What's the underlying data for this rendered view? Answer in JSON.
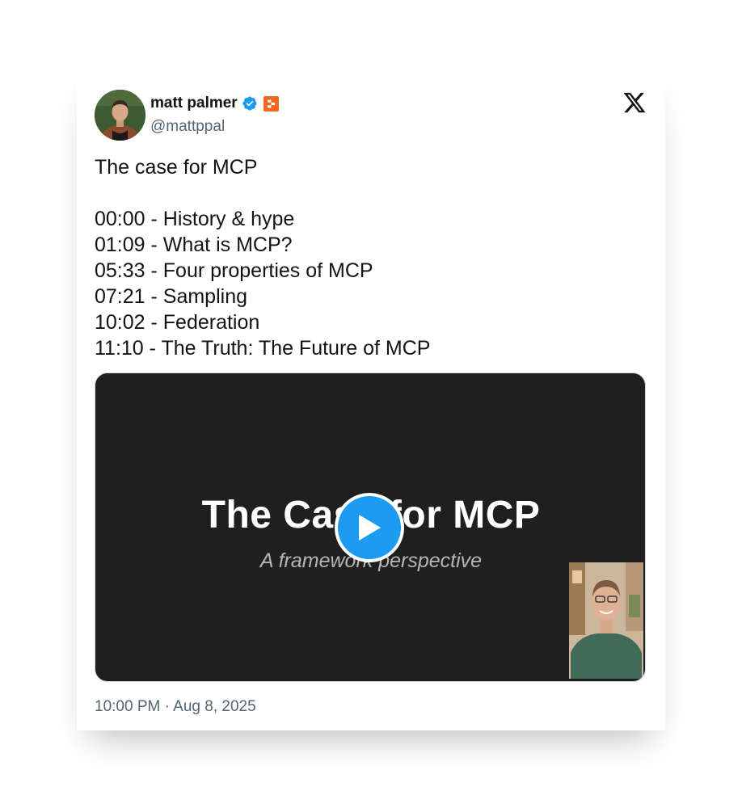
{
  "author": {
    "name": "matt palmer",
    "handle": "@mattppal",
    "verified": true,
    "avatar_icon": "profile-photo-man",
    "affiliate_badge_icon": "replit-logo",
    "affiliate_badge_color": "#F26522"
  },
  "platform_icon": "x-logo",
  "tweet": {
    "lines": [
      "The case for MCP",
      "",
      "00:00 - History & hype",
      "01:09 - What is MCP?",
      "05:33 - Four properties of MCP",
      "07:21 - Sampling",
      "10:02 - Federation",
      "11:10 - The Truth: The Future of MCP"
    ]
  },
  "video": {
    "slide_title": "The Case for MCP",
    "slide_subtitle": "A framework perspective",
    "play_icon": "play-icon",
    "play_button_color": "#1D9BF0",
    "pip_icon": "presenter-webcam"
  },
  "timestamp": "10:00 PM · Aug 8, 2025"
}
